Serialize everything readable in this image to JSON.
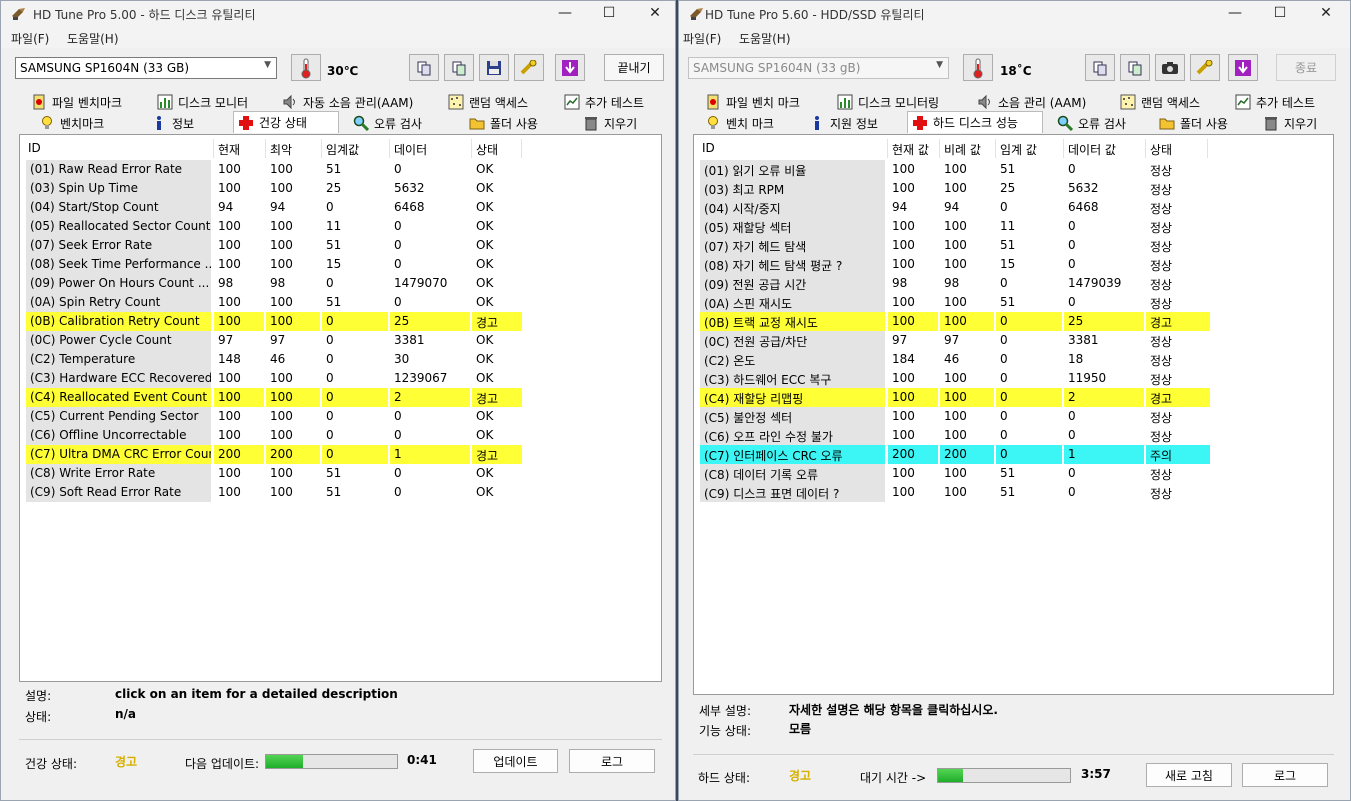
{
  "winA": {
    "title": "HD Tune Pro 5.00 - 하드 디스크 유틸리티",
    "menu": [
      "파일(F)",
      "도움말(H)"
    ],
    "drive": "SAMSUNG SP1604N (33 GB)",
    "temperature": "30℃",
    "exit_label": "끝내기",
    "tabs_top": [
      "파일 벤치마크",
      "디스크 모니터",
      "자동 소음 관리(AAM)",
      "랜덤 액세스",
      "추가 테스트"
    ],
    "tabs_bottom": [
      "벤치마크",
      "정보",
      "건강 상태",
      "오류 검사",
      "폴더 사용",
      "지우기"
    ],
    "columns": [
      "ID",
      "현재",
      "최악",
      "임계값",
      "데이터",
      "상태"
    ],
    "rows": [
      {
        "id": "(01) Raw Read Error Rate",
        "cur": "100",
        "worst": "100",
        "thr": "51",
        "data": "0",
        "status": "OK",
        "flag": ""
      },
      {
        "id": "(03) Spin Up Time",
        "cur": "100",
        "worst": "100",
        "thr": "25",
        "data": "5632",
        "status": "OK",
        "flag": ""
      },
      {
        "id": "(04) Start/Stop Count",
        "cur": "94",
        "worst": "94",
        "thr": "0",
        "data": "6468",
        "status": "OK",
        "flag": ""
      },
      {
        "id": "(05) Reallocated Sector Count",
        "cur": "100",
        "worst": "100",
        "thr": "11",
        "data": "0",
        "status": "OK",
        "flag": ""
      },
      {
        "id": "(07) Seek Error Rate",
        "cur": "100",
        "worst": "100",
        "thr": "51",
        "data": "0",
        "status": "OK",
        "flag": ""
      },
      {
        "id": "(08) Seek Time Performance      ...",
        "cur": "100",
        "worst": "100",
        "thr": "15",
        "data": "0",
        "status": "OK",
        "flag": ""
      },
      {
        "id": "(09) Power On Hours Count      ...",
        "cur": "98",
        "worst": "98",
        "thr": "0",
        "data": "1479070",
        "status": "OK",
        "flag": ""
      },
      {
        "id": "(0A) Spin Retry Count",
        "cur": "100",
        "worst": "100",
        "thr": "51",
        "data": "0",
        "status": "OK",
        "flag": ""
      },
      {
        "id": "(0B) Calibration Retry Count",
        "cur": "100",
        "worst": "100",
        "thr": "0",
        "data": "25",
        "status": "경고",
        "flag": "warn"
      },
      {
        "id": "(0C) Power Cycle Count",
        "cur": "97",
        "worst": "97",
        "thr": "0",
        "data": "3381",
        "status": "OK",
        "flag": ""
      },
      {
        "id": "(C2) Temperature",
        "cur": "148",
        "worst": "46",
        "thr": "0",
        "data": "30",
        "status": "OK",
        "flag": ""
      },
      {
        "id": "(C3) Hardware ECC Recovered  ...",
        "cur": "100",
        "worst": "100",
        "thr": "0",
        "data": "1239067",
        "status": "OK",
        "flag": ""
      },
      {
        "id": "(C4) Reallocated Event Count",
        "cur": "100",
        "worst": "100",
        "thr": "0",
        "data": "2",
        "status": "경고",
        "flag": "warn"
      },
      {
        "id": "(C5) Current Pending Sector",
        "cur": "100",
        "worst": "100",
        "thr": "0",
        "data": "0",
        "status": "OK",
        "flag": ""
      },
      {
        "id": "(C6) Offline Uncorrectable",
        "cur": "100",
        "worst": "100",
        "thr": "0",
        "data": "0",
        "status": "OK",
        "flag": ""
      },
      {
        "id": "(C7) Ultra DMA CRC Error Coun...",
        "cur": "200",
        "worst": "200",
        "thr": "0",
        "data": "1",
        "status": "경고",
        "flag": "warn"
      },
      {
        "id": "(C8) Write Error Rate",
        "cur": "100",
        "worst": "100",
        "thr": "51",
        "data": "0",
        "status": "OK",
        "flag": ""
      },
      {
        "id": "(C9) Soft Read Error Rate",
        "cur": "100",
        "worst": "100",
        "thr": "51",
        "data": "0",
        "status": "OK",
        "flag": ""
      }
    ],
    "desc_label": "설명:",
    "desc_value": "click on an item for a detailed description",
    "state_label": "상태:",
    "state_value": "n/a",
    "health_label": "건강 상태:",
    "health_value": "경고",
    "next_update_label": "다음 업데이트:",
    "progress_fraction": 0.28,
    "timer": "0:41",
    "update_label": "업데이트",
    "log_label": "로그"
  },
  "winB": {
    "title": "HD Tune Pro 5.60 - HDD/SSD  유틸리티",
    "menu": [
      "파일(F)",
      "도움말(H)"
    ],
    "drive": "SAMSUNG SP1604N (33 gB)",
    "temperature": "18˚C",
    "exit_label": "종료",
    "tabs_top": [
      "파일 벤치 마크",
      "디스크 모니터링",
      "소음 관리 (AAM)",
      "랜덤 액세스",
      "추가 테스트"
    ],
    "tabs_bottom": [
      "벤치 마크",
      "지원 정보",
      "하드 디스크 성능",
      "오류 검사",
      "폴더 사용",
      "지우기"
    ],
    "columns": [
      "ID",
      "현재 값",
      "비례 값",
      "임계 값",
      "데이터 값",
      "상태"
    ],
    "rows": [
      {
        "id": "(01) 읽기 오류 비율",
        "cur": "100",
        "worst": "100",
        "thr": "51",
        "data": "0",
        "status": "정상",
        "flag": ""
      },
      {
        "id": "(03) 최고 RPM",
        "cur": "100",
        "worst": "100",
        "thr": "25",
        "data": "5632",
        "status": "정상",
        "flag": ""
      },
      {
        "id": "(04) 시작/중지",
        "cur": "94",
        "worst": "94",
        "thr": "0",
        "data": "6468",
        "status": "정상",
        "flag": ""
      },
      {
        "id": "(05) 재할당 섹터",
        "cur": "100",
        "worst": "100",
        "thr": "11",
        "data": "0",
        "status": "정상",
        "flag": ""
      },
      {
        "id": "(07) 자기 헤드 탐색",
        "cur": "100",
        "worst": "100",
        "thr": "51",
        "data": "0",
        "status": "정상",
        "flag": ""
      },
      {
        "id": "(08) 자기 헤드 탐색 평균 ?",
        "cur": "100",
        "worst": "100",
        "thr": "15",
        "data": "0",
        "status": "정상",
        "flag": ""
      },
      {
        "id": "(09) 전원 공급 시간",
        "cur": "98",
        "worst": "98",
        "thr": "0",
        "data": "1479039",
        "status": "정상",
        "flag": ""
      },
      {
        "id": "(0A) 스핀 재시도",
        "cur": "100",
        "worst": "100",
        "thr": "51",
        "data": "0",
        "status": "정상",
        "flag": ""
      },
      {
        "id": "(0B) 트랙 교정 재시도",
        "cur": "100",
        "worst": "100",
        "thr": "0",
        "data": "25",
        "status": "경고",
        "flag": "warn"
      },
      {
        "id": "(0C) 전원 공급/차단",
        "cur": "97",
        "worst": "97",
        "thr": "0",
        "data": "3381",
        "status": "정상",
        "flag": ""
      },
      {
        "id": "(C2) 온도",
        "cur": "184",
        "worst": "46",
        "thr": "0",
        "data": "18",
        "status": "정상",
        "flag": ""
      },
      {
        "id": "(C3) 하드웨어 ECC 복구",
        "cur": "100",
        "worst": "100",
        "thr": "0",
        "data": "11950",
        "status": "정상",
        "flag": ""
      },
      {
        "id": "(C4) 재할당 리맵핑",
        "cur": "100",
        "worst": "100",
        "thr": "0",
        "data": "2",
        "status": "경고",
        "flag": "warn"
      },
      {
        "id": "(C5) 불안정 섹터",
        "cur": "100",
        "worst": "100",
        "thr": "0",
        "data": "0",
        "status": "정상",
        "flag": ""
      },
      {
        "id": "(C6) 오프 라인 수정 불가",
        "cur": "100",
        "worst": "100",
        "thr": "0",
        "data": "0",
        "status": "정상",
        "flag": ""
      },
      {
        "id": "(C7) 인터페이스 CRC 오류",
        "cur": "200",
        "worst": "200",
        "thr": "0",
        "data": "1",
        "status": "주의",
        "flag": "caution"
      },
      {
        "id": "(C8) 데이터 기록 오류",
        "cur": "100",
        "worst": "100",
        "thr": "51",
        "data": "0",
        "status": "정상",
        "flag": ""
      },
      {
        "id": "(C9) 디스크 표면 데이터 ?",
        "cur": "100",
        "worst": "100",
        "thr": "51",
        "data": "0",
        "status": "정상",
        "flag": ""
      }
    ],
    "desc_label": "세부 설명:",
    "desc_value": "자세한 설명은 해당 항목을 클릭하십시오.",
    "state_label": "기능 상태:",
    "state_value": "모름",
    "health_label": "하드 상태:",
    "health_value": "경고",
    "next_update_label": "대기 시간 ->",
    "progress_fraction": 0.19,
    "timer": "3:57",
    "update_label": "새로 고침",
    "log_label": "로그"
  },
  "colors": {
    "warn_row": "#ffff35",
    "caution_row": "#3cf6f6",
    "health_text": "#d6b000",
    "progress": "#2fbe3a"
  }
}
